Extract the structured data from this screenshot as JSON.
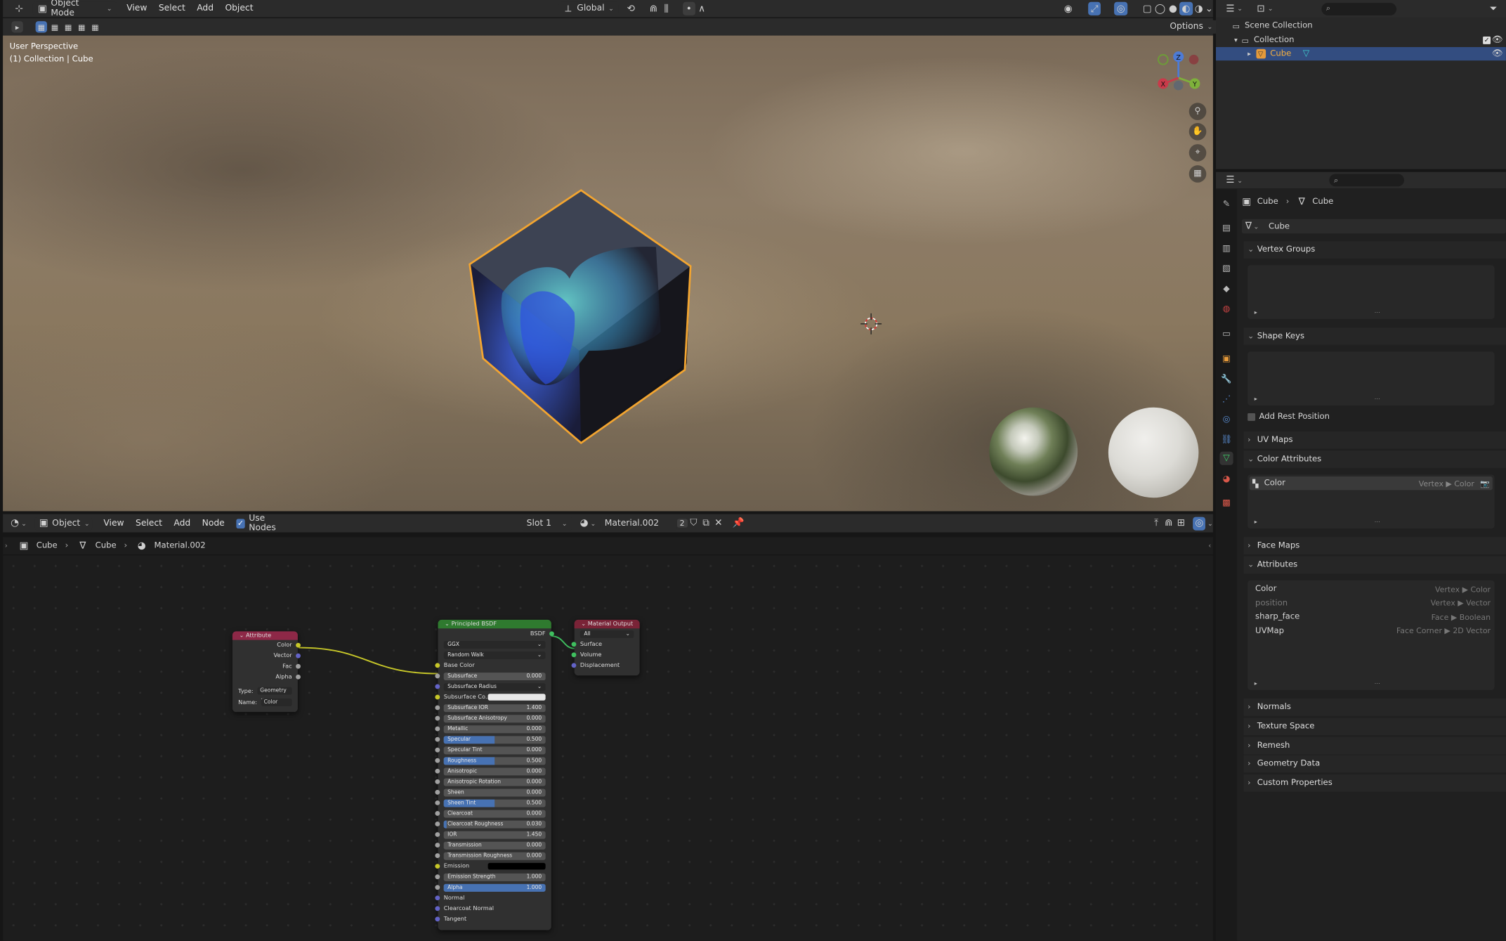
{
  "top_header": {
    "mode": "Object Mode",
    "menu": [
      "View",
      "Select",
      "Add",
      "Object"
    ],
    "orientation": "Global",
    "options_label": "Options"
  },
  "viewport": {
    "perspective_label": "User Perspective",
    "collection_label": "(1) Collection | Cube",
    "gizmo_axes": {
      "z": "Z",
      "y": "Y",
      "x": "X"
    }
  },
  "node_header": {
    "type": "Object",
    "menu": [
      "View",
      "Select",
      "Add",
      "Node"
    ],
    "use_nodes_label": "Use Nodes",
    "use_nodes_checked": true,
    "slot": "Slot 1",
    "material": "Material.002",
    "users": "2"
  },
  "node_breadcrumb": [
    "Cube",
    "Cube",
    "Material.002"
  ],
  "nodes": {
    "attribute": {
      "title": "Attribute",
      "outputs": [
        "Color",
        "Vector",
        "Fac",
        "Alpha"
      ],
      "type_label": "Type:",
      "type_value": "Geometry",
      "name_label": "Name:",
      "name_value": "Color"
    },
    "bsdf": {
      "title": "Principled BSDF",
      "output": "BSDF",
      "distribution": "GGX",
      "subsurface_method": "Random Walk",
      "base_color_label": "Base Color",
      "fields": [
        {
          "label": "Subsurface",
          "value": "0.000",
          "fill": 0
        },
        {
          "label": "Subsurface Radius",
          "value": "",
          "fill": 0,
          "dropdown": true
        },
        {
          "label": "Subsurface Co...",
          "value": "",
          "fill": 0,
          "swatch": "#e8e8e8"
        },
        {
          "label": "Subsurface IOR",
          "value": "1.400",
          "fill": 0
        },
        {
          "label": "Subsurface Anisotropy",
          "value": "0.000",
          "fill": 0
        },
        {
          "label": "Metallic",
          "value": "0.000",
          "fill": 0
        },
        {
          "label": "Specular",
          "value": "0.500",
          "fill": 0.5
        },
        {
          "label": "Specular Tint",
          "value": "0.000",
          "fill": 0
        },
        {
          "label": "Roughness",
          "value": "0.500",
          "fill": 0.5
        },
        {
          "label": "Anisotropic",
          "value": "0.000",
          "fill": 0
        },
        {
          "label": "Anisotropic Rotation",
          "value": "0.000",
          "fill": 0
        },
        {
          "label": "Sheen",
          "value": "0.000",
          "fill": 0
        },
        {
          "label": "Sheen Tint",
          "value": "0.500",
          "fill": 0.5
        },
        {
          "label": "Clearcoat",
          "value": "0.000",
          "fill": 0
        },
        {
          "label": "Clearcoat Roughness",
          "value": "0.030",
          "fill": 0.03
        },
        {
          "label": "IOR",
          "value": "1.450",
          "fill": 0
        },
        {
          "label": "Transmission",
          "value": "0.000",
          "fill": 0
        },
        {
          "label": "Transmission Roughness",
          "value": "0.000",
          "fill": 0
        },
        {
          "label": "Emission",
          "value": "",
          "fill": 0,
          "swatch": "#000000"
        },
        {
          "label": "Emission Strength",
          "value": "1.000",
          "fill": 0
        },
        {
          "label": "Alpha",
          "value": "1.000",
          "fill": 1
        }
      ],
      "bottom_inputs": [
        "Normal",
        "Clearcoat Normal",
        "Tangent"
      ]
    },
    "output": {
      "title": "Material Output",
      "target": "All",
      "inputs": [
        "Surface",
        "Volume",
        "Displacement"
      ]
    }
  },
  "outliner": {
    "items": [
      "Scene Collection",
      "Collection",
      "Cube"
    ]
  },
  "properties": {
    "breadcrumb": [
      "Cube",
      "Cube"
    ],
    "mesh_name": "Cube",
    "sections": {
      "vertex_groups": "Vertex Groups",
      "shape_keys": "Shape Keys",
      "add_rest_position": "Add Rest Position",
      "uv_maps": "UV Maps",
      "color_attributes": "Color Attributes",
      "face_maps": "Face Maps",
      "attributes": "Attributes",
      "normals": "Normals",
      "texture_space": "Texture Space",
      "remesh": "Remesh",
      "geometry_data": "Geometry Data",
      "custom_properties": "Custom Properties"
    },
    "color_attribute": {
      "name": "Color",
      "domain": "Vertex ▶ Color"
    },
    "attributes": [
      {
        "name": "Color",
        "domain": "Vertex ▶ Color"
      },
      {
        "name": "position",
        "domain": "Vertex ▶ Vector"
      },
      {
        "name": "sharp_face",
        "domain": "Face ▶ Boolean"
      },
      {
        "name": "UVMap",
        "domain": "Face Corner ▶ 2D Vector"
      }
    ]
  },
  "colors": {
    "accent": "#4772b3",
    "selected_outline": "#f3a530",
    "bsdf_header": "#2f7a2f",
    "attribute_header": "#8d2847",
    "output_header": "#7a2337"
  }
}
